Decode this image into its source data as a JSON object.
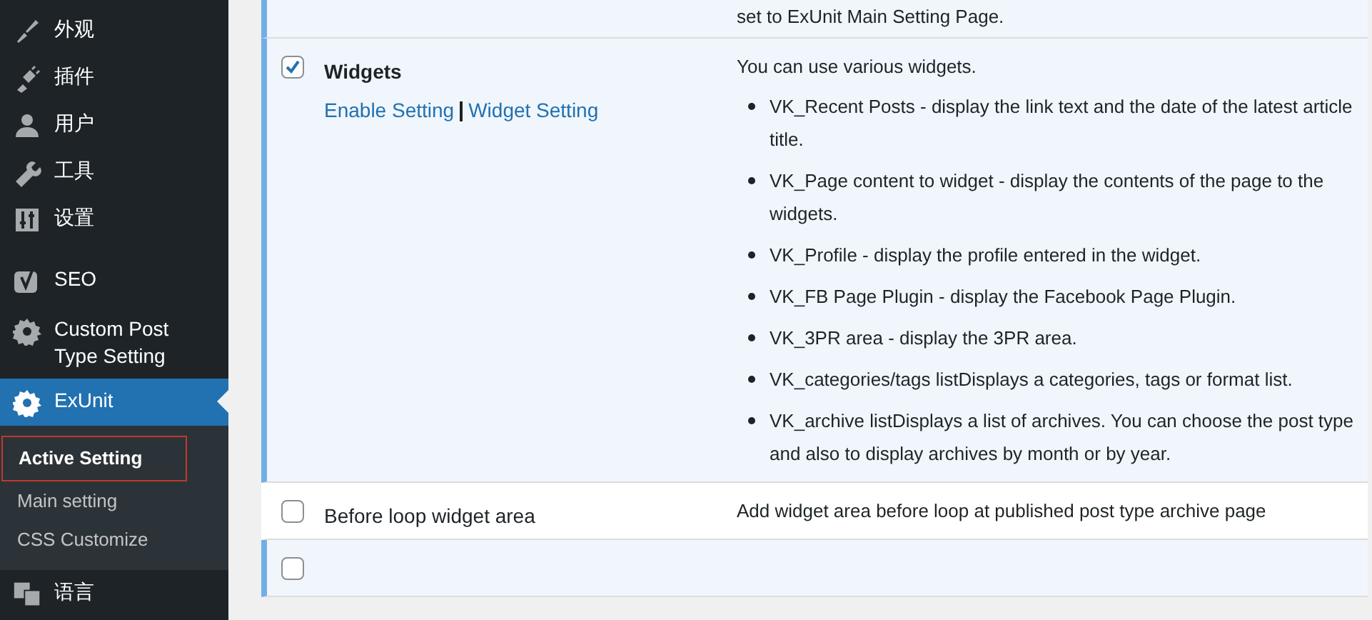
{
  "sidebar": {
    "items": [
      {
        "kind": "appearance",
        "label": "外观",
        "selected": false
      },
      {
        "kind": "plugins",
        "label": "插件",
        "selected": false
      },
      {
        "kind": "users",
        "label": "用户",
        "selected": false
      },
      {
        "kind": "tools",
        "label": "工具",
        "selected": false
      },
      {
        "kind": "settings",
        "label": "设置",
        "selected": false
      },
      {
        "kind": "seo",
        "label": "SEO",
        "selected": false
      },
      {
        "kind": "gear",
        "label": "Custom Post Type Setting",
        "selected": false
      },
      {
        "kind": "gear",
        "label": "ExUnit",
        "selected": true,
        "children": [
          {
            "label": "Active Setting",
            "selected": true
          },
          {
            "label": "Main setting",
            "selected": false
          },
          {
            "label": "CSS Customize",
            "selected": false
          }
        ]
      },
      {
        "kind": "language",
        "label": "语言",
        "selected": false
      }
    ]
  },
  "rows": [
    {
      "active": true,
      "description": "set to ExUnit Main Setting Page."
    },
    {
      "active": true,
      "checked": true,
      "title": "Widgets",
      "links": [
        "Enable Setting",
        "Widget Setting"
      ],
      "description": "You can use various widgets.",
      "bullets": [
        "VK_Recent Posts - display the link text and the date of the latest article title.",
        "VK_Page content to widget - display the contents of the page to the widgets.",
        "VK_Profile - display the profile entered in the widget.",
        "VK_FB Page Plugin - display the Facebook Page Plugin.",
        "VK_3PR area - display the 3PR area.",
        "VK_categories/tags listDisplays a categories, tags or format list.",
        "VK_archive listDisplays a list of archives. You can choose the post type and also to display archives by month or by year."
      ]
    },
    {
      "active": false,
      "checked": false,
      "title": "Before loop widget area",
      "description": "Add widget area before loop at published post type archive page"
    },
    {
      "active": true,
      "checked": false
    }
  ]
}
